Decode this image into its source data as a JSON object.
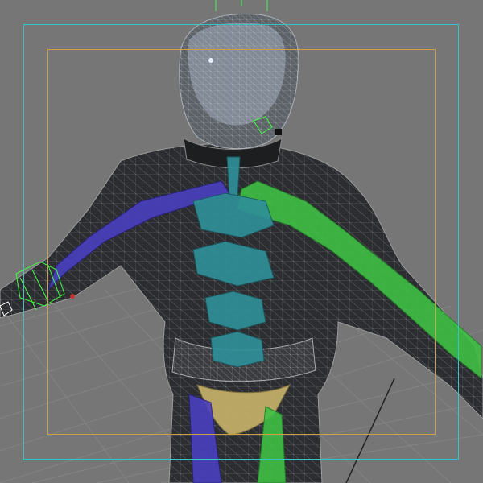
{
  "viewport": {
    "view_mode": "perspective",
    "background_color": "#767676",
    "grid_color": "#8a8a8a",
    "safe_frame_outer_color": "#34c6c6",
    "safe_frame_inner_color": "#d0a040"
  },
  "scene": {
    "mesh": {
      "display": "shaded-wireframe",
      "color": "#2b2d30",
      "wire_color": "#c8c8c8"
    },
    "bones": {
      "spine": {
        "color": "#2f8f98"
      },
      "arm_left": {
        "color": "#4a3fc0"
      },
      "arm_right": {
        "color": "#3fbf45"
      },
      "leg_left": {
        "color": "#4a3fc0"
      },
      "leg_right": {
        "color": "#3fbf45"
      },
      "pelvis": {
        "color": "#c9b36a"
      }
    },
    "helpers": {
      "color": "#40ff40",
      "icon": "bone-helper-icon"
    }
  }
}
